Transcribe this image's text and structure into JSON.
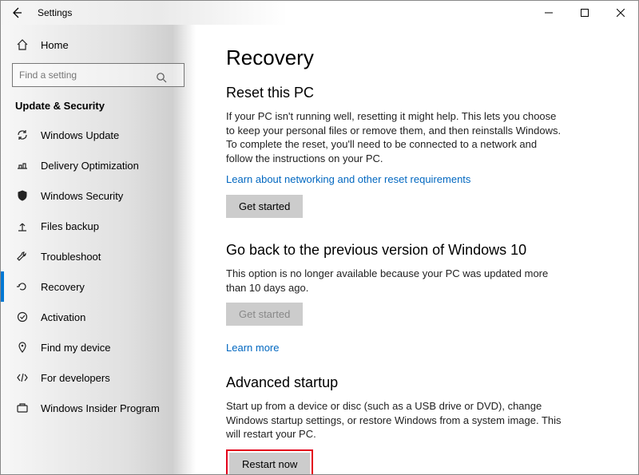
{
  "window": {
    "title": "Settings"
  },
  "sidebar": {
    "home": "Home",
    "search_placeholder": "Find a setting",
    "category": "Update & Security",
    "items": [
      {
        "label": "Windows Update"
      },
      {
        "label": "Delivery Optimization"
      },
      {
        "label": "Windows Security"
      },
      {
        "label": "Files backup"
      },
      {
        "label": "Troubleshoot"
      },
      {
        "label": "Recovery"
      },
      {
        "label": "Activation"
      },
      {
        "label": "Find my device"
      },
      {
        "label": "For developers"
      },
      {
        "label": "Windows Insider Program"
      }
    ]
  },
  "main": {
    "title": "Recovery",
    "reset": {
      "heading": "Reset this PC",
      "body": "If your PC isn't running well, resetting it might help. This lets you choose to keep your personal files or remove them, and then reinstalls Windows. To complete the reset, you'll need to be connected to a network and follow the instructions on your PC.",
      "link": "Learn about networking and other reset requirements",
      "button": "Get started"
    },
    "goback": {
      "heading": "Go back to the previous version of Windows 10",
      "body": "This option is no longer available because your PC was updated more than 10 days ago.",
      "button": "Get started",
      "link": "Learn more"
    },
    "advanced": {
      "heading": "Advanced startup",
      "body": "Start up from a device or disc (such as a USB drive or DVD), change Windows startup settings, or restore Windows from a system image. This will restart your PC.",
      "button": "Restart now"
    }
  }
}
